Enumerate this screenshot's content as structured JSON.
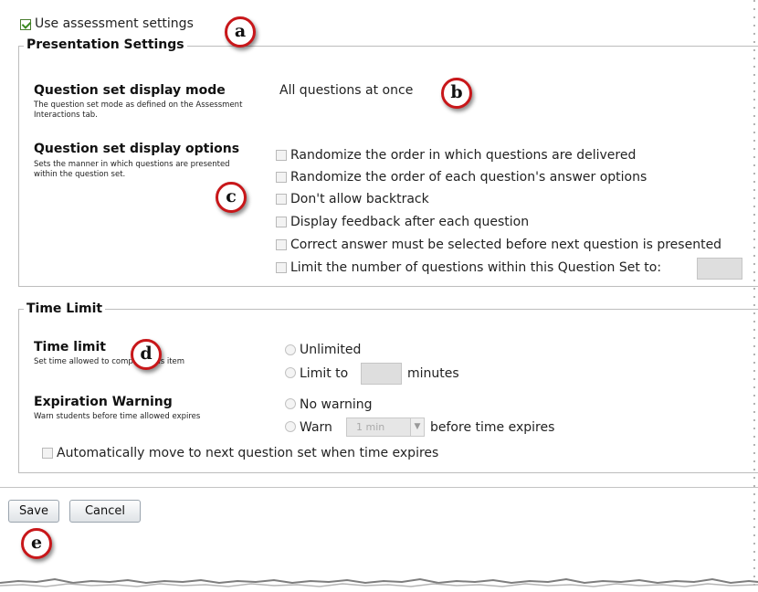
{
  "top": {
    "use_assessment_label": "Use assessment settings"
  },
  "presentation": {
    "legend": "Presentation Settings",
    "mode_title": "Question set display mode",
    "mode_desc": "The question set mode as defined on the Assessment Interactions tab.",
    "mode_value": "All questions at once",
    "options_title": "Question set display options",
    "options_desc": "Sets the manner in which questions are presented within the question set.",
    "options": [
      "Randomize the order in which questions are delivered",
      "Randomize the order of each question's answer options",
      "Don't allow backtrack",
      "Display feedback after each question",
      "Correct answer must be selected before next question is presented",
      "Limit the number of questions within this Question Set to:"
    ]
  },
  "time": {
    "legend": "Time Limit",
    "limit_title": "Time limit",
    "limit_desc": "Set time allowed to complete this item",
    "unlimited_label": "Unlimited",
    "limit_to_label": "Limit to",
    "minutes_label": "minutes",
    "warning_title": "Expiration Warning",
    "warning_desc": "Warn students before time allowed expires",
    "no_warning_label": "No warning",
    "warn_label": "Warn",
    "warn_select_value": "1 min",
    "before_expires_label": "before time expires",
    "auto_move_label": "Automatically move to next question set when time expires"
  },
  "buttons": {
    "save": "Save",
    "cancel": "Cancel"
  },
  "markers": {
    "a": "a",
    "b": "b",
    "c": "c",
    "d": "d",
    "e": "e"
  },
  "colors": {
    "marker_ring": "#c8171a",
    "check_green": "#3a8a1f"
  }
}
